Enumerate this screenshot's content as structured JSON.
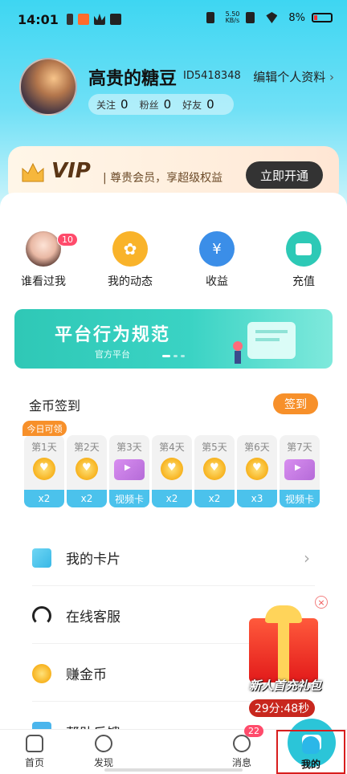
{
  "status_bar": {
    "time": "14:01",
    "network_speed": "5.50\nKB/s",
    "battery": "8%"
  },
  "profile": {
    "name": "高贵的糖豆",
    "id": "ID5418348",
    "edit_label": "编辑个人资料",
    "stats": [
      {
        "label": "关注",
        "value": "0"
      },
      {
        "label": "粉丝",
        "value": "0"
      },
      {
        "label": "好友",
        "value": "0"
      }
    ]
  },
  "vip": {
    "title": "VIP",
    "description": "| 尊贵会员，享超级权益",
    "button": "立即开通"
  },
  "quick_actions": [
    {
      "label": "谁看过我",
      "badge": "10",
      "icon": "visitor-avatar-icon",
      "color": "#f2c6b4"
    },
    {
      "label": "我的动态",
      "icon": "moments-icon",
      "color": "#f9b32a"
    },
    {
      "label": "收益",
      "icon": "earnings-icon",
      "color": "#3b8ee8"
    },
    {
      "label": "充值",
      "icon": "wallet-icon",
      "color": "#2dc9b6"
    }
  ],
  "banner": {
    "title": "平台行为规范",
    "subtitle": "官方平台"
  },
  "checkin": {
    "title": "金币签到",
    "button": "签到",
    "today_tag": "今日可领",
    "days": [
      {
        "label": "第1天",
        "reward": "x2",
        "type": "coin"
      },
      {
        "label": "第2天",
        "reward": "x2",
        "type": "coin"
      },
      {
        "label": "第3天",
        "reward": "视频卡",
        "type": "video"
      },
      {
        "label": "第4天",
        "reward": "x2",
        "type": "coin"
      },
      {
        "label": "第5天",
        "reward": "x2",
        "type": "coin"
      },
      {
        "label": "第6天",
        "reward": "x3",
        "type": "coin"
      },
      {
        "label": "第7天",
        "reward": "视频卡",
        "type": "video"
      }
    ]
  },
  "menu": [
    {
      "label": "我的卡片",
      "icon": "card-icon"
    },
    {
      "label": "在线客服",
      "icon": "headset-icon"
    },
    {
      "label": "赚金币",
      "icon": "coin-icon"
    },
    {
      "label": "帮助反馈",
      "icon": "help-icon"
    }
  ],
  "gift": {
    "text": "新人首充礼包",
    "timer": "29分:48秒"
  },
  "nav": [
    {
      "label": "首页"
    },
    {
      "label": "发现"
    },
    {
      "label": ""
    },
    {
      "label": "消息",
      "badge": "22"
    },
    {
      "label": "我的"
    }
  ]
}
